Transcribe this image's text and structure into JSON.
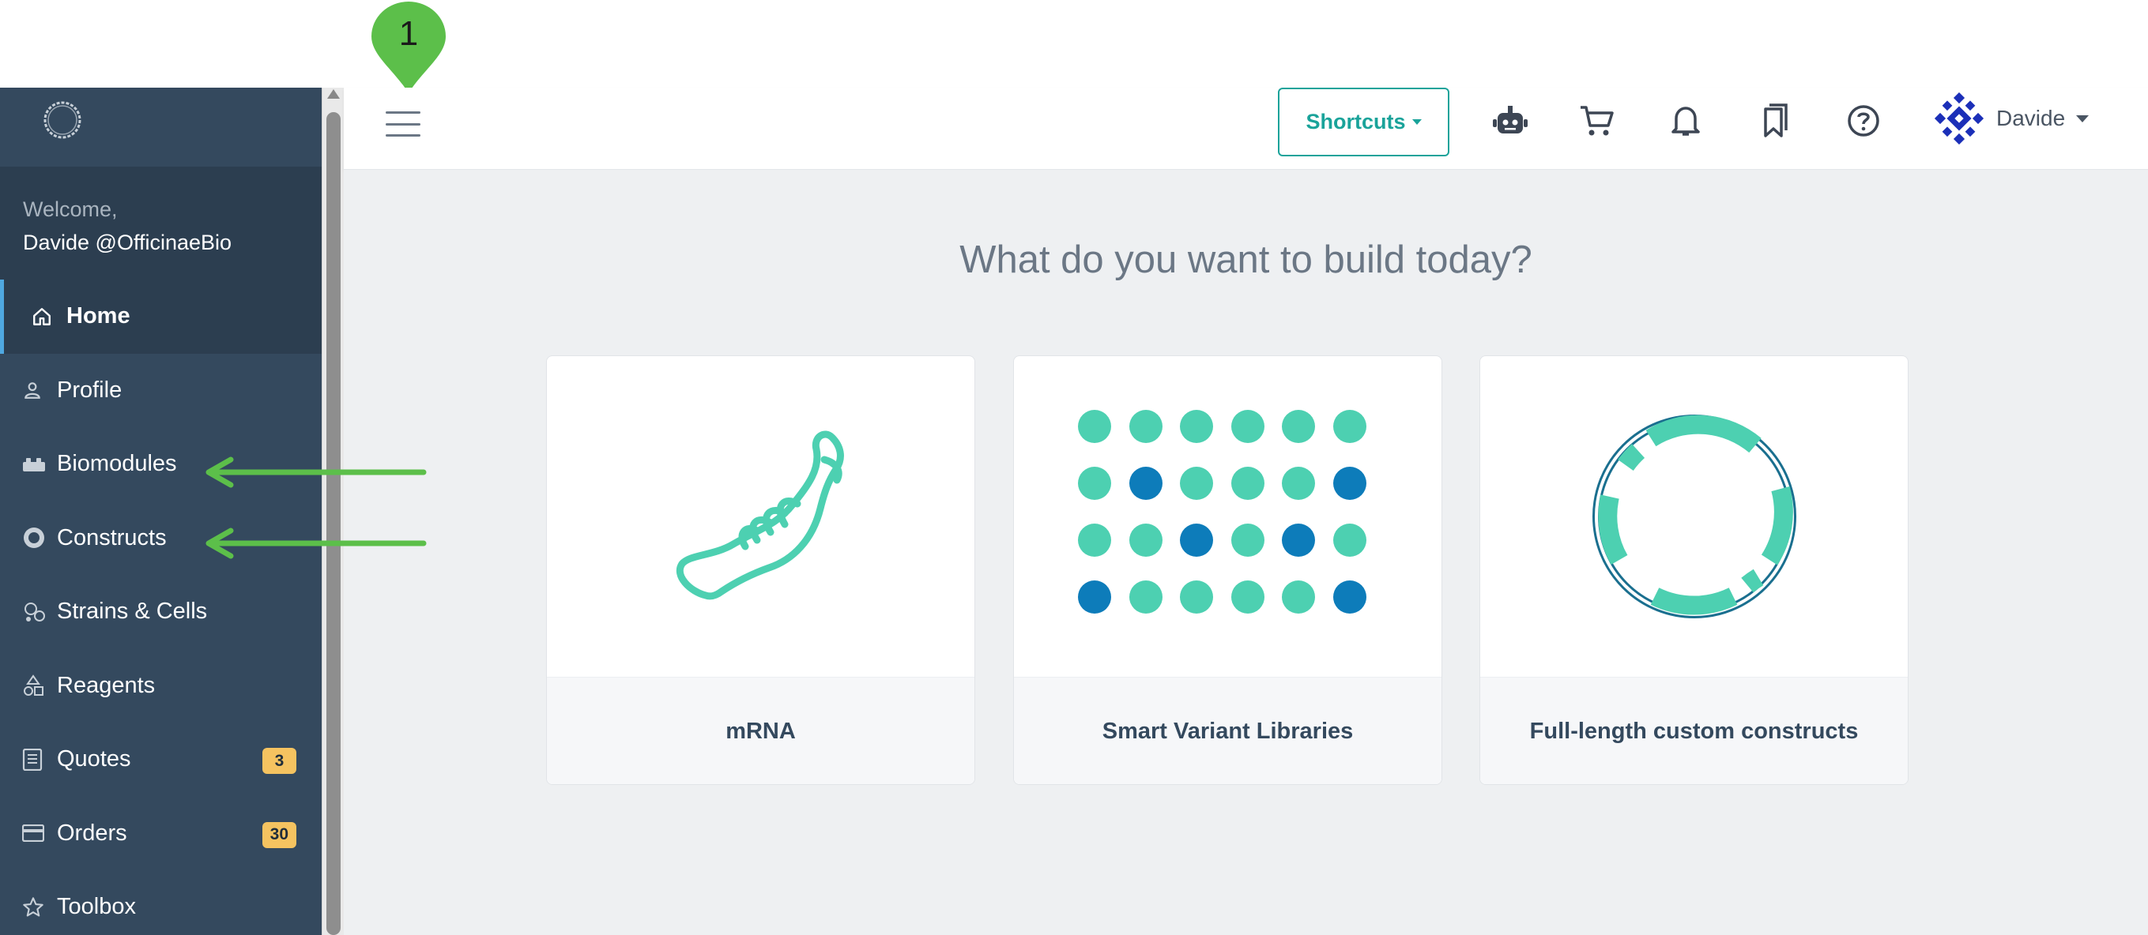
{
  "sidebar": {
    "welcome": "Welcome,",
    "user": "Davide @OfficinaeBio",
    "items": [
      {
        "label": "Home",
        "icon": "home-icon"
      },
      {
        "label": "Profile",
        "icon": "user-icon"
      },
      {
        "label": "Biomodules",
        "icon": "blocks-icon"
      },
      {
        "label": "Constructs",
        "icon": "plasmid-icon"
      },
      {
        "label": "Strains & Cells",
        "icon": "cells-icon"
      },
      {
        "label": "Reagents",
        "icon": "shapes-icon"
      },
      {
        "label": "Quotes",
        "icon": "document-icon",
        "badge": "3"
      },
      {
        "label": "Orders",
        "icon": "card-icon",
        "badge": "30"
      },
      {
        "label": "Toolbox",
        "icon": "star-icon"
      }
    ]
  },
  "header": {
    "shortcuts_label": "Shortcuts",
    "user_name": "Davide",
    "icons": [
      "robot-icon",
      "cart-icon",
      "bell-icon",
      "bookmarks-icon",
      "help-icon"
    ]
  },
  "main": {
    "headline": "What do you want to build today?",
    "cards": [
      {
        "label": "mRNA",
        "icon": "mrna-icon"
      },
      {
        "label": "Smart Variant Libraries",
        "icon": "variant-dots-icon"
      },
      {
        "label": "Full-length custom constructs",
        "icon": "plasmid-ring-icon"
      }
    ]
  },
  "annotation": {
    "marker_number": "1"
  },
  "colors": {
    "sidebar_bg": "#34495e",
    "sidebar_dark": "#2c3e50",
    "accent_teal": "#1aa39a",
    "mint": "#4dd0b1",
    "dot_blue": "#0d7cba",
    "badge_yellow": "#f5c360",
    "annotation_green": "#5cbf4a"
  }
}
